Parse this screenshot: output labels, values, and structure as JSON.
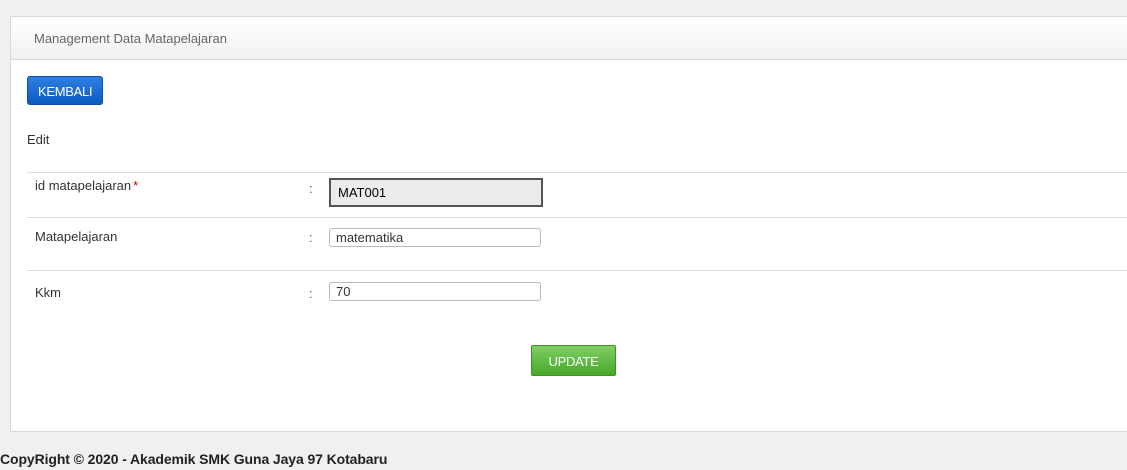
{
  "panel": {
    "title": "Management Data Matapelajaran"
  },
  "toolbar": {
    "back_label": "KEMBALI"
  },
  "section": {
    "title": "Edit"
  },
  "form": {
    "fields": [
      {
        "label": "id matapelajaran",
        "required_mark": "*",
        "separator": ":",
        "value": "MAT001"
      },
      {
        "label": "Matapelajaran",
        "separator": ":",
        "value": "matematika"
      },
      {
        "label": "Kkm",
        "separator": ":",
        "value": "70"
      }
    ],
    "submit_label": "UPDATE"
  },
  "footer": {
    "text": "CopyRight © 2020 - Akademik SMK Guna Jaya 97 Kotabaru"
  },
  "colors": {
    "primary_button": "#0b5bc6",
    "success_button": "#46a82a",
    "required": "#d00000"
  }
}
